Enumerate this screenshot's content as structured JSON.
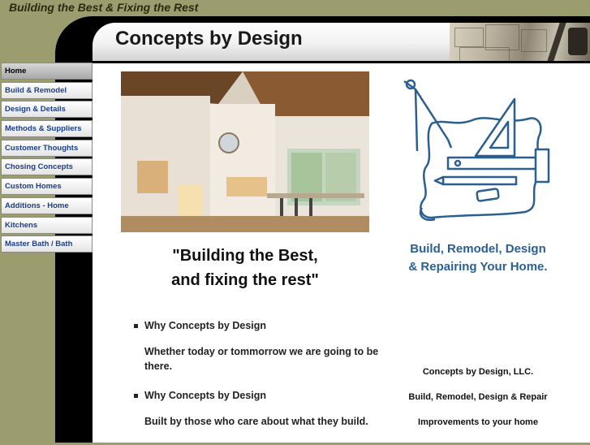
{
  "header": {
    "tagline": "Building the Best & Fixing the Rest",
    "site_title": "Concepts by Design"
  },
  "sidebar": {
    "items": [
      {
        "label": "Home",
        "active": true
      },
      {
        "label": "Build & Remodel"
      },
      {
        "label": "Design & Details"
      },
      {
        "label": "Methods & Suppliers"
      },
      {
        "label": "Customer Thoughts"
      },
      {
        "label": "Chosing Concepts"
      },
      {
        "label": "Custom Homes"
      },
      {
        "label": "Additions - Home"
      },
      {
        "label": "Kitchens"
      },
      {
        "label": "Master Bath / Bath"
      }
    ]
  },
  "main": {
    "quote_line1": "\"Building the Best,",
    "quote_line2": "and fixing the rest\"",
    "bullets": [
      {
        "heading": "Why Concepts by Design",
        "text": "Whether today or tommorrow we are going to be there."
      },
      {
        "heading": "Why Concepts by Design",
        "text": "Built by those who care about what they build."
      }
    ],
    "services_line1": "Build, Remodel, Design",
    "services_line2": "& Repairing Your Home.",
    "company_info": [
      "Concepts by Design, LLC.",
      "Build, Remodel, Design & Repair",
      "Improvements to your home"
    ]
  },
  "colors": {
    "background": "#9c9d6f",
    "nav_text": "#1b3e8a",
    "accent_blue": "#2b5f92"
  }
}
